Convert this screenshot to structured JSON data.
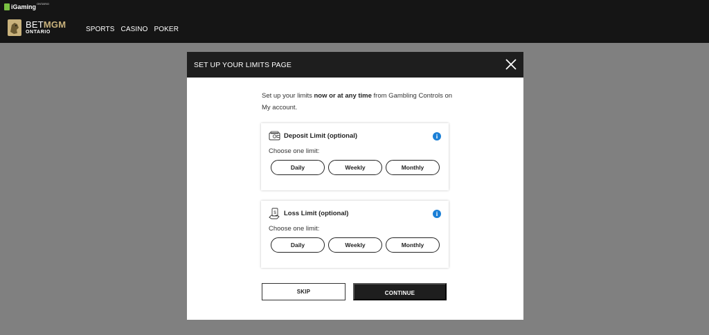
{
  "header": {
    "igaming_badge": {
      "text": "iGaming",
      "sup": "ONTARIO"
    },
    "brand": {
      "bet": "BET",
      "mgm": "MGM",
      "region": "ONTARIO"
    },
    "nav": [
      "SPORTS",
      "CASINO",
      "POKER"
    ]
  },
  "modal": {
    "title": "SET UP YOUR LIMITS PAGE",
    "intro": {
      "before": "Set up your limits ",
      "bold": "now or at any time",
      "after": " from Gambling Controls on My account."
    },
    "cards": [
      {
        "title": "Deposit Limit (optional)",
        "subtitle": "Choose one limit:",
        "icon": "wallet-icon",
        "options": [
          "Daily",
          "Weekly",
          "Monthly"
        ]
      },
      {
        "title": "Loss Limit (optional)",
        "subtitle": "Choose one limit:",
        "icon": "money-hand-icon",
        "options": [
          "Daily",
          "Weekly",
          "Monthly"
        ]
      }
    ],
    "info_glyph": "i",
    "skip_label": "SKIP",
    "continue_label": "CONTINUE"
  },
  "colors": {
    "overlay": "#808080",
    "topbar": "#151515",
    "brand_gold": "#c9b27c",
    "info_blue": "#1b7fd6",
    "igaming_green": "#7ac142"
  }
}
